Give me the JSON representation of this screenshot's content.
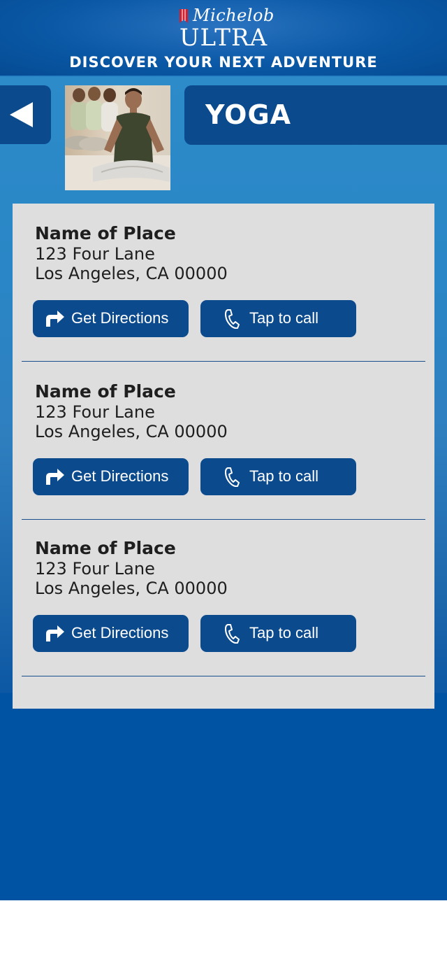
{
  "header": {
    "logo_script": "Michelob",
    "logo_wordmark": "ULTRA",
    "tagline": "DISCOVER YOUR NEXT ADVENTURE"
  },
  "category": {
    "title": "YOGA",
    "photo_icon": "yoga-class-photo"
  },
  "places": [
    {
      "name": "Name of Place",
      "street": "123 Four Lane",
      "city": "Los Angeles, CA 00000",
      "directions_label": "Get Directions",
      "call_label": "Tap to call"
    },
    {
      "name": "Name of Place",
      "street": "123 Four Lane",
      "city": "Los Angeles, CA 00000",
      "directions_label": "Get Directions",
      "call_label": "Tap to call"
    },
    {
      "name": "Name of Place",
      "street": "123 Four Lane",
      "city": "Los Angeles, CA 00000",
      "directions_label": "Get Directions",
      "call_label": "Tap to call"
    }
  ],
  "icons": {
    "back": "back-arrow-icon",
    "directions": "turn-right-arrow-icon",
    "call": "phone-handset-icon"
  },
  "colors": {
    "brand_blue": "#0c4a8e",
    "background_blue": "#2a86c6",
    "panel_gray": "#dedede",
    "logo_red": "#d2202f"
  }
}
